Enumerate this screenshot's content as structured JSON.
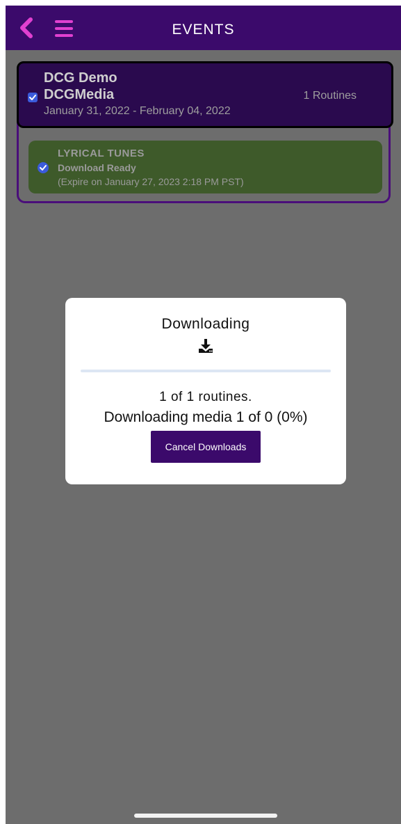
{
  "header": {
    "title": "EVENTS",
    "back_icon": "chevron-left-icon",
    "menu_icon": "hamburger-menu-icon",
    "accent_color": "#e040d0",
    "background_color": "#3b0a6b"
  },
  "event": {
    "name": "DCG Demo",
    "organization": "DCGMedia",
    "dates": "January 31, 2022 - February 04, 2022",
    "routines_count": "1 Routines",
    "selected": true
  },
  "routine": {
    "title": "LYRICAL TUNES",
    "status": "Download Ready",
    "expiry": "(Expire on January 27, 2023 2:18 PM PST)",
    "selected": true
  },
  "modal": {
    "title": "Downloading",
    "icon": "download-icon",
    "progress_percent": 0,
    "routines_text": "1 of 1 routines.",
    "media_text": "Downloading media 1 of 0 (0%)",
    "cancel_label": "Cancel Downloads"
  }
}
